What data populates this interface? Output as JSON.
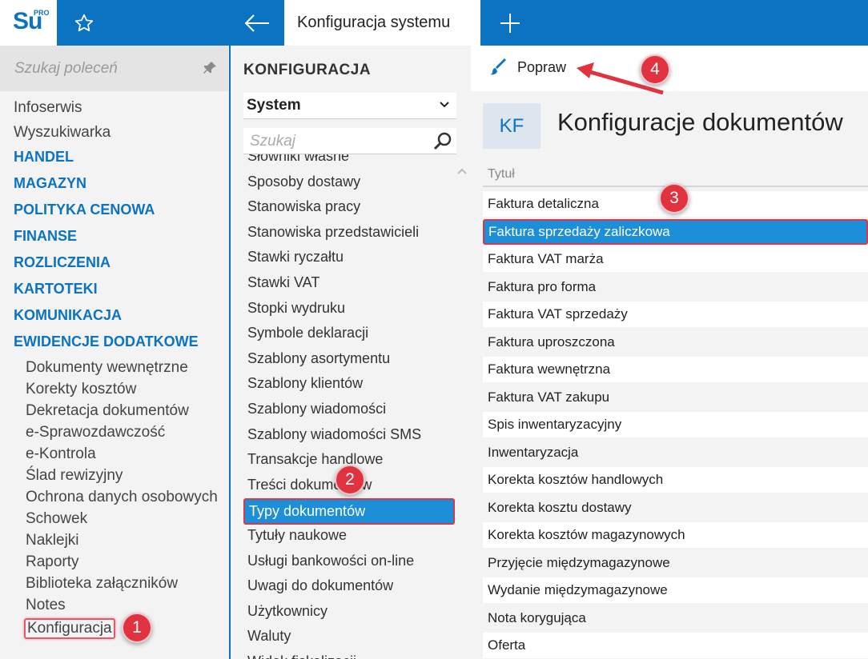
{
  "app": {
    "logo_text": "Su",
    "logo_badge": "PRO",
    "tab_title": "Konfiguracja systemu",
    "icons": {
      "favorite": "star-icon",
      "back": "arrow-left-icon",
      "new_tab": "plus-icon"
    },
    "colors": {
      "brand": "#0b73c2",
      "selection": "#1c8fd8",
      "annotation": "#e0323f"
    }
  },
  "sidebar": {
    "search_placeholder": "Szukaj poleceń",
    "items": [
      {
        "label": "Infoserwis",
        "type": "link"
      },
      {
        "label": "Wyszukiwarka",
        "type": "link"
      },
      {
        "label": "HANDEL",
        "type": "section"
      },
      {
        "label": "MAGAZYN",
        "type": "section"
      },
      {
        "label": "POLITYKA CENOWA",
        "type": "section"
      },
      {
        "label": "FINANSE",
        "type": "section"
      },
      {
        "label": "ROZLICZENIA",
        "type": "section"
      },
      {
        "label": "KARTOTEKI",
        "type": "section"
      },
      {
        "label": "KOMUNIKACJA",
        "type": "section"
      },
      {
        "label": "EWIDENCJE DODATKOWE",
        "type": "section"
      },
      {
        "label": "Dokumenty wewnętrzne",
        "type": "sub"
      },
      {
        "label": "Korekty kosztów",
        "type": "sub"
      },
      {
        "label": "Dekretacja dokumentów",
        "type": "sub"
      },
      {
        "label": "e-Sprawozdawczość",
        "type": "sub"
      },
      {
        "label": "e-Kontrola",
        "type": "sub"
      },
      {
        "label": "Ślad rewizyjny",
        "type": "sub"
      },
      {
        "label": "Ochrona danych osobowych",
        "type": "sub"
      },
      {
        "label": "Schowek",
        "type": "sub"
      },
      {
        "label": "Naklejki",
        "type": "sub"
      },
      {
        "label": "Raporty",
        "type": "sub"
      },
      {
        "label": "Biblioteka załączników",
        "type": "sub"
      },
      {
        "label": "Notes",
        "type": "sub"
      },
      {
        "label": "Konfiguracja",
        "type": "sub",
        "selected": true
      }
    ]
  },
  "middle": {
    "title": "KONFIGURACJA",
    "dropdown_value": "System",
    "search_placeholder": "Szukaj",
    "items": [
      "Słowniki własne",
      "Sposoby dostawy",
      "Stanowiska pracy",
      "Stanowiska przedstawicieli",
      "Stawki ryczałtu",
      "Stawki VAT",
      "Stopki wydruku",
      "Symbole deklaracji",
      "Szablony asortymentu",
      "Szablony klientów",
      "Szablony wiadomości",
      "Szablony wiadomości SMS",
      "Transakcje handlowe",
      "Treści dokumentów",
      "Typy dokumentów",
      "Tytuły naukowe",
      "Usługi bankowości on-line",
      "Uwagi do dokumentów",
      "Użytkownicy",
      "Waluty",
      "Widok fiskalizacji"
    ],
    "selected_index": 14
  },
  "right": {
    "toolbar_action": "Popraw",
    "badge_text": "KF",
    "title": "Konfiguracje dokumentów",
    "column_header": "Tytuł",
    "rows": [
      "Faktura detaliczna",
      "Faktura sprzedaży zaliczkowa",
      "Faktura VAT marża",
      "Faktura pro forma",
      "Faktura VAT sprzedaży",
      "Faktura uproszczona",
      "Faktura wewnętrzna",
      "Faktura VAT zakupu",
      "Spis inwentaryzacyjny",
      "Inwentaryzacja",
      "Korekta kosztów handlowych",
      "Korekta kosztu dostawy",
      "Korekta kosztów magazynowych",
      "Przyjęcie międzymagazynowe",
      "Wydanie międzymagazynowe",
      "Nota korygująca",
      "Oferta"
    ],
    "selected_index": 1
  },
  "annotations": [
    "1",
    "2",
    "3",
    "4"
  ]
}
